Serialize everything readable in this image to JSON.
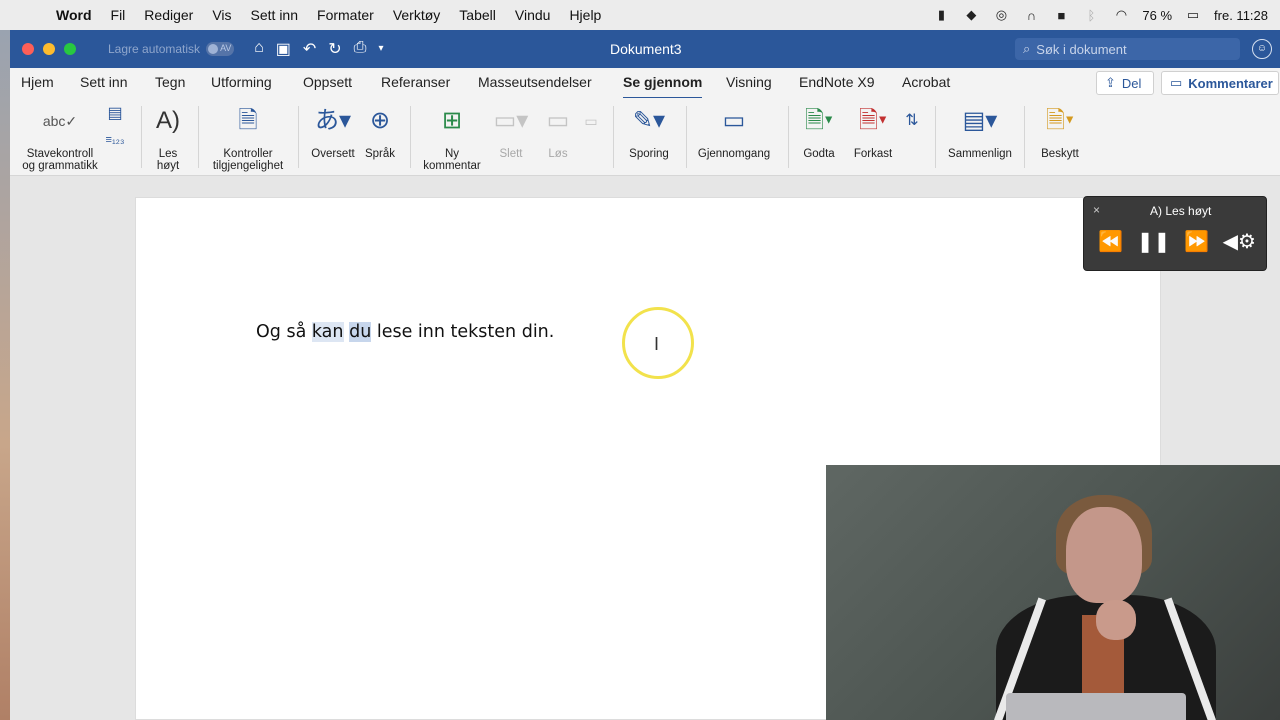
{
  "menubar": {
    "items": [
      "Word",
      "Fil",
      "Rediger",
      "Vis",
      "Sett inn",
      "Formater",
      "Verktøy",
      "Tabell",
      "Vindu",
      "Hjelp"
    ],
    "battery": "76 %",
    "clock": "fre. 11:28"
  },
  "titlebar": {
    "autosave_label": "Lagre automatisk",
    "autosave_state": "AV",
    "document_title": "Dokument3",
    "search_placeholder": "Søk i dokument"
  },
  "tabs": [
    "Hjem",
    "Sett inn",
    "Tegn",
    "Utforming",
    "Oppsett",
    "Referanser",
    "Masseutsendelser",
    "Se gjennom",
    "Visning",
    "EndNote X9",
    "Acrobat"
  ],
  "active_tab": "Se gjennom",
  "share_label": "Del",
  "comments_label": "Kommentarer",
  "ribbon": {
    "spelling": "Stavekontroll og grammatikk",
    "read_aloud": "Les høyt",
    "accessibility": "Kontroller tilgjengelighet",
    "translate": "Oversett",
    "language": "Språk",
    "new_comment": "Ny kommentar",
    "delete": "Slett",
    "resolve": "Løs",
    "tracking": "Sporing",
    "review": "Gjennomgang",
    "accept": "Godta",
    "reject": "Forkast",
    "compare": "Sammenlign",
    "protect": "Beskytt"
  },
  "document": {
    "before": "Og så ",
    "w1": "kan",
    "space1": " ",
    "w2": "du",
    "after": " lese inn teksten din."
  },
  "read_aloud_panel": {
    "title": "Les høyt",
    "close": "×"
  },
  "colors": {
    "word_blue": "#2b579a",
    "highlight": "#dde6f3",
    "cursor_ring": "#f2e24c"
  }
}
